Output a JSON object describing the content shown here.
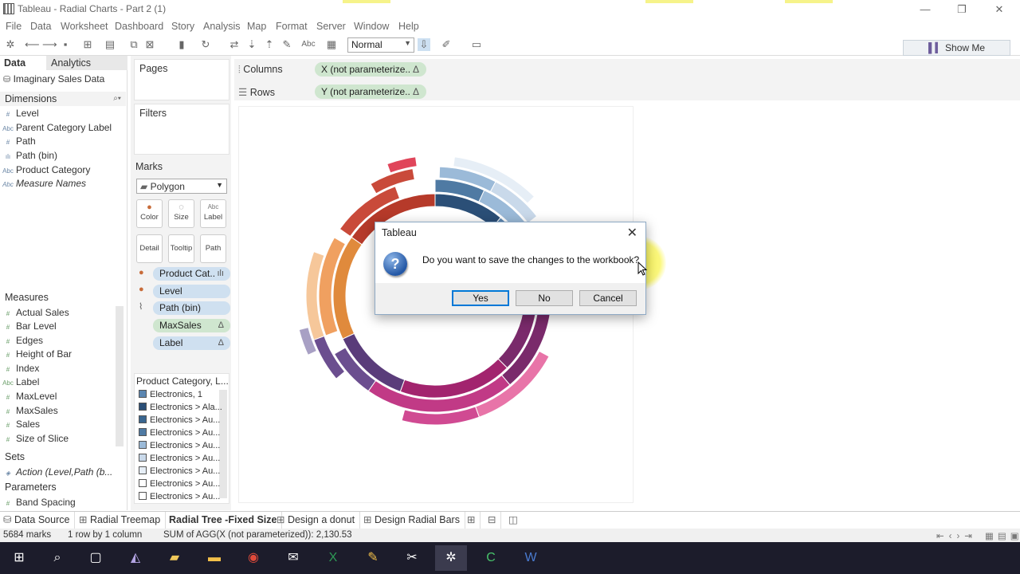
{
  "window": {
    "title": "Tableau - Radial Charts - Part 2 (1)",
    "controls": {
      "minimize": "—",
      "maximize": "❐",
      "close": "✕"
    }
  },
  "menu": [
    "File",
    "Data",
    "Worksheet",
    "Dashboard",
    "Story",
    "Analysis",
    "Map",
    "Format",
    "Server",
    "Window",
    "Help"
  ],
  "toolbar": {
    "mark_type_select": "Normal",
    "show_me": "Show Me"
  },
  "left_pane": {
    "tabs": [
      "Data",
      "Analytics"
    ],
    "datasource": "Imaginary Sales Data",
    "dimensions_header": "Dimensions",
    "dimensions": [
      {
        "icon": "#",
        "label": "Level"
      },
      {
        "icon": "Abc",
        "label": "Parent Category Label"
      },
      {
        "icon": "#",
        "label": "Path"
      },
      {
        "icon": "ılı",
        "label": "Path (bin)"
      },
      {
        "icon": "Abc",
        "label": "Product Category"
      },
      {
        "icon": "Abc",
        "label": "Measure Names"
      }
    ],
    "measures_header": "Measures",
    "measures": [
      {
        "icon": "#",
        "label": "Actual Sales"
      },
      {
        "icon": "#",
        "label": "Bar Level"
      },
      {
        "icon": "#",
        "label": "Edges"
      },
      {
        "icon": "#",
        "label": "Height of Bar"
      },
      {
        "icon": "#",
        "label": "Index"
      },
      {
        "icon": "Abc",
        "label": "Label"
      },
      {
        "icon": "#",
        "label": "MaxLevel"
      },
      {
        "icon": "#",
        "label": "MaxSales"
      },
      {
        "icon": "#",
        "label": "Sales"
      },
      {
        "icon": "#",
        "label": "Size of Slice"
      }
    ],
    "sets_header": "Sets",
    "sets": [
      {
        "label": "Action (Level,Path (b..."
      }
    ],
    "parameters_header": "Parameters",
    "parameters": [
      {
        "icon": "#",
        "label": "Band Spacing"
      }
    ]
  },
  "cards": {
    "pages": "Pages",
    "filters": "Filters",
    "marks": "Marks",
    "mark_type": "Polygon",
    "mark_buttons": [
      {
        "label": "Color",
        "icon": "●"
      },
      {
        "label": "Size",
        "icon": "◌"
      },
      {
        "label": "Label",
        "icon": "Abc"
      },
      {
        "label": "Detail",
        "icon": ""
      },
      {
        "label": "Tooltip",
        "icon": ""
      },
      {
        "label": "Path",
        "icon": ""
      }
    ],
    "mark_pills": [
      {
        "label": "Product Cat..",
        "delta": "ılı",
        "color": "blue"
      },
      {
        "label": "Level",
        "delta": "",
        "color": "blue"
      },
      {
        "label": "Path (bin)",
        "delta": "",
        "color": "blue"
      },
      {
        "label": "MaxSales",
        "delta": "Δ",
        "color": "green"
      },
      {
        "label": "Label",
        "delta": "Δ",
        "color": "blue"
      }
    ],
    "legend_title": "Product Category, L...",
    "legend_items": [
      {
        "label": "Electronics, 1",
        "color": "#5b86b1"
      },
      {
        "label": "Electronics > Ala...",
        "color": "#2b4f77"
      },
      {
        "label": "Electronics > Au...",
        "color": "#3a6690"
      },
      {
        "label": "Electronics > Au...",
        "color": "#4f7aa3"
      },
      {
        "label": "Electronics > Au...",
        "color": "#9bbad8"
      },
      {
        "label": "Electronics > Au...",
        "color": "#c9d9ea"
      },
      {
        "label": "Electronics > Au...",
        "color": "#e6eef6"
      },
      {
        "label": "Electronics > Au...",
        "color": "#ffffff"
      },
      {
        "label": "Electronics > Au...",
        "color": "#ffffff"
      }
    ]
  },
  "shelves": {
    "columns_label": "Columns",
    "columns_pill": "X (not parameterize..",
    "rows_label": "Rows",
    "rows_pill": "Y (not parameterize..",
    "pill_delta": "Δ"
  },
  "dialog": {
    "title": "Tableau",
    "message": "Do you want to save the changes to the workbook?",
    "buttons": [
      "Yes",
      "No",
      "Cancel"
    ]
  },
  "sheet_tabs": [
    {
      "label": "Data Source",
      "active": false
    },
    {
      "label": "Radial Treemap",
      "active": false
    },
    {
      "label": "Radial Tree -Fixed Size",
      "active": true
    },
    {
      "label": "Design a donut",
      "active": false
    },
    {
      "label": "Design Radial Bars",
      "active": false
    }
  ],
  "status": {
    "marks": "5684 marks",
    "dims": "1 row by 1 column",
    "sum": "SUM of AGG(X (not parameterized)): 2,130.53"
  },
  "colors": {
    "accent_blue": "#0078d7",
    "pill_blue": "#cfe0f0",
    "pill_green": "#cfe6cf",
    "taskbar": "#1c1c2b"
  }
}
